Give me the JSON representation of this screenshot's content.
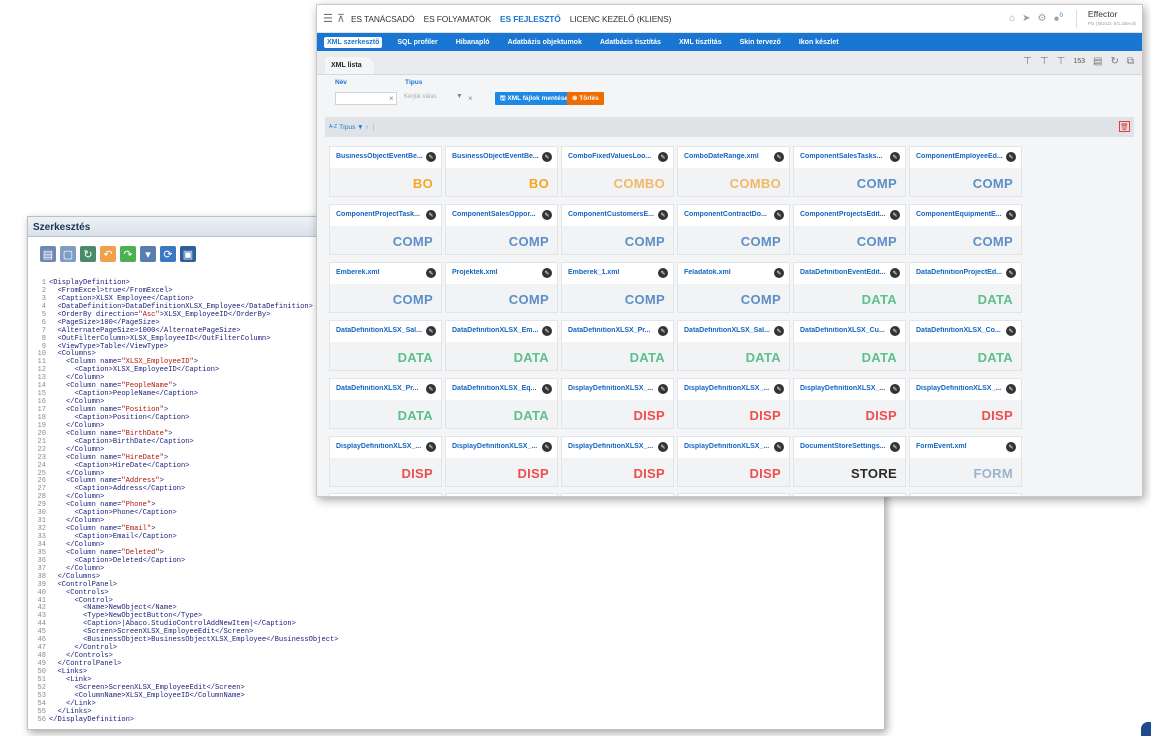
{
  "editor": {
    "title": "Szerkesztés",
    "toolbar_icons": [
      "open-icon",
      "new-document-icon",
      "refresh-document-icon",
      "undo-icon",
      "redo-icon",
      "download-icon",
      "reload-icon",
      "save-icon"
    ],
    "code_lines": [
      {
        "n": "1",
        "t": "<DisplayDefinition>"
      },
      {
        "n": "2",
        "t": "  <FromExcel>true</FromExcel>"
      },
      {
        "n": "3",
        "t": "  <Caption>XLSX Employee</Caption>"
      },
      {
        "n": "4",
        "t": "  <DataDefinition>DataDefinitionXLSX_Employee</DataDefinition>"
      },
      {
        "n": "5",
        "t": "  <OrderBy direction=\"Asc\">XLSX_EmployeeID</OrderBy>"
      },
      {
        "n": "6",
        "t": "  <PageSize>100</PageSize>"
      },
      {
        "n": "7",
        "t": "  <AlternatePageSize>1000</AlternatePageSize>"
      },
      {
        "n": "8",
        "t": "  <OutFilterColumn>XLSX_EmployeeID</OutFilterColumn>"
      },
      {
        "n": "9",
        "t": "  <ViewType>Table</ViewType>"
      },
      {
        "n": "10",
        "t": "  <Columns>"
      },
      {
        "n": "11",
        "t": "    <Column name=\"XLSX_EmployeeID\">"
      },
      {
        "n": "12",
        "t": "      <Caption>XLSX_EmployeeID</Caption>"
      },
      {
        "n": "13",
        "t": "    </Column>"
      },
      {
        "n": "14",
        "t": "    <Column name=\"PeopleName\">"
      },
      {
        "n": "15",
        "t": "      <Caption>PeopleName</Caption>"
      },
      {
        "n": "16",
        "t": "    </Column>"
      },
      {
        "n": "17",
        "t": "    <Column name=\"Position\">"
      },
      {
        "n": "18",
        "t": "      <Caption>Position</Caption>"
      },
      {
        "n": "19",
        "t": "    </Column>"
      },
      {
        "n": "20",
        "t": "    <Column name=\"BirthDate\">"
      },
      {
        "n": "21",
        "t": "      <Caption>BirthDate</Caption>"
      },
      {
        "n": "22",
        "t": "    </Column>"
      },
      {
        "n": "23",
        "t": "    <Column name=\"HireDate\">"
      },
      {
        "n": "24",
        "t": "      <Caption>HireDate</Caption>"
      },
      {
        "n": "25",
        "t": "    </Column>"
      },
      {
        "n": "26",
        "t": "    <Column name=\"Address\">"
      },
      {
        "n": "27",
        "t": "      <Caption>Address</Caption>"
      },
      {
        "n": "28",
        "t": "    </Column>"
      },
      {
        "n": "29",
        "t": "    <Column name=\"Phone\">"
      },
      {
        "n": "30",
        "t": "      <Caption>Phone</Caption>"
      },
      {
        "n": "31",
        "t": "    </Column>"
      },
      {
        "n": "32",
        "t": "    <Column name=\"Email\">"
      },
      {
        "n": "33",
        "t": "      <Caption>Email</Caption>"
      },
      {
        "n": "34",
        "t": "    </Column>"
      },
      {
        "n": "35",
        "t": "    <Column name=\"Deleted\">"
      },
      {
        "n": "36",
        "t": "      <Caption>Deleted</Caption>"
      },
      {
        "n": "37",
        "t": "    </Column>"
      },
      {
        "n": "38",
        "t": "  </Columns>"
      },
      {
        "n": "39",
        "t": "  <ControlPanel>"
      },
      {
        "n": "40",
        "t": "    <Controls>"
      },
      {
        "n": "41",
        "t": "      <Control>"
      },
      {
        "n": "42",
        "t": "        <Name>NewObject</Name>"
      },
      {
        "n": "43",
        "t": "        <Type>NewObjectButton</Type>"
      },
      {
        "n": "44",
        "t": "        <Caption>|Abaco.StudioControlAddNewItem|</Caption>"
      },
      {
        "n": "45",
        "t": "        <Screen>ScreenXLSX_EmployeeEdit</Screen>"
      },
      {
        "n": "46",
        "t": "        <BusinessObject>BusinessObjectXLSX_Employee</BusinessObject>"
      },
      {
        "n": "47",
        "t": "      </Control>"
      },
      {
        "n": "48",
        "t": "    </Controls>"
      },
      {
        "n": "49",
        "t": "  </ControlPanel>"
      },
      {
        "n": "50",
        "t": "  <Links>"
      },
      {
        "n": "51",
        "t": "    <Link>"
      },
      {
        "n": "52",
        "t": "      <Screen>ScreenXLSX_EmployeeEdit</Screen>"
      },
      {
        "n": "53",
        "t": "      <ColumnName>XLSX_EmployeeID</ColumnName>"
      },
      {
        "n": "54",
        "t": "    </Link>"
      },
      {
        "n": "55",
        "t": "  </Links>"
      },
      {
        "n": "56",
        "t": "</DisplayDefinition>"
      }
    ]
  },
  "app": {
    "topnav": [
      "ES TANÁCSADÓ",
      "ES FOLYAMATOK",
      "ES FEJLESZTŐ",
      "LICENC KEZELŐ (KLIENS)"
    ],
    "topnav_active": 2,
    "brand": "Effector",
    "brand_sub": "PG | BUILD: 0/1.2dev.rb",
    "notif_count": "0",
    "subnav": [
      "XML szerkesztő",
      "SQL profiler",
      "Hibanapló",
      "Adatbázis objektumok",
      "Adatbázis tisztítás",
      "XML tisztítás",
      "Skin tervező",
      "Ikon készlet"
    ],
    "subnav_active": 0,
    "tab": "XML lista",
    "record_count": "153",
    "filter": {
      "name_label": "Név",
      "name_value": "",
      "type_label": "Típus",
      "type_placeholder": "Kérjük válas",
      "save_button": "XML fájlok mentése",
      "delete_button": "Törlés"
    },
    "sort_label": "Típus",
    "sort_az": "A-Z",
    "cards": [
      {
        "title": "BusinessObjectEventBe...",
        "type": "BO"
      },
      {
        "title": "BusinessObjectEventBe...",
        "type": "BO"
      },
      {
        "title": "ComboFixedValuesLoo...",
        "type": "COMBO"
      },
      {
        "title": "ComboDateRange.xml",
        "type": "COMBO"
      },
      {
        "title": "ComponentSalesTasks...",
        "type": "COMP"
      },
      {
        "title": "ComponentEmployeeEd...",
        "type": "COMP"
      },
      {
        "title": "ComponentProjectTask...",
        "type": "COMP"
      },
      {
        "title": "ComponentSalesOppor...",
        "type": "COMP"
      },
      {
        "title": "ComponentCustomersE...",
        "type": "COMP"
      },
      {
        "title": "ComponentContractDo...",
        "type": "COMP"
      },
      {
        "title": "ComponentProjectsEdit...",
        "type": "COMP"
      },
      {
        "title": "ComponentEquipmentE...",
        "type": "COMP"
      },
      {
        "title": "Emberek.xml",
        "type": "COMP"
      },
      {
        "title": "Projektek.xml",
        "type": "COMP"
      },
      {
        "title": "Emberek_1.xml",
        "type": "COMP"
      },
      {
        "title": "Feladatok.xml",
        "type": "COMP"
      },
      {
        "title": "DataDefinitionEventEdit...",
        "type": "DATA"
      },
      {
        "title": "DataDefinitionProjectEd...",
        "type": "DATA"
      },
      {
        "title": "DataDefinitionXLSX_Sal...",
        "type": "DATA"
      },
      {
        "title": "DataDefinitionXLSX_Em...",
        "type": "DATA"
      },
      {
        "title": "DataDefinitionXLSX_Pr...",
        "type": "DATA"
      },
      {
        "title": "DataDefinitionXLSX_Sal...",
        "type": "DATA"
      },
      {
        "title": "DataDefinitionXLSX_Cu...",
        "type": "DATA"
      },
      {
        "title": "DataDefinitionXLSX_Co...",
        "type": "DATA"
      },
      {
        "title": "DataDefinitionXLSX_Pr...",
        "type": "DATA"
      },
      {
        "title": "DataDefinitionXLSX_Eq...",
        "type": "DATA"
      },
      {
        "title": "DisplayDefinitionXLSX_...",
        "type": "DISP"
      },
      {
        "title": "DisplayDefinitionXLSX_...",
        "type": "DISP"
      },
      {
        "title": "DisplayDefinitionXLSX_...",
        "type": "DISP"
      },
      {
        "title": "DisplayDefinitionXLSX_...",
        "type": "DISP"
      },
      {
        "title": "DisplayDefinitionXLSX_...",
        "type": "DISP"
      },
      {
        "title": "DisplayDefinitionXLSX_...",
        "type": "DISP"
      },
      {
        "title": "DisplayDefinitionXLSX_...",
        "type": "DISP"
      },
      {
        "title": "DisplayDefinitionXLSX_...",
        "type": "DISP"
      },
      {
        "title": "DocumentStoreSettings...",
        "type": "STORE"
      },
      {
        "title": "FormEvent.xml",
        "type": "FORM"
      }
    ],
    "colors": {
      "accent": "#1976d2",
      "BO": "#f5a623",
      "COMBO": "#f3b766",
      "COMP": "#5b8fc7",
      "DATA": "#5fbf8f",
      "DISP": "#ef4e4e",
      "STORE": "#2b2b2b",
      "FORM": "#9db3cc"
    }
  }
}
